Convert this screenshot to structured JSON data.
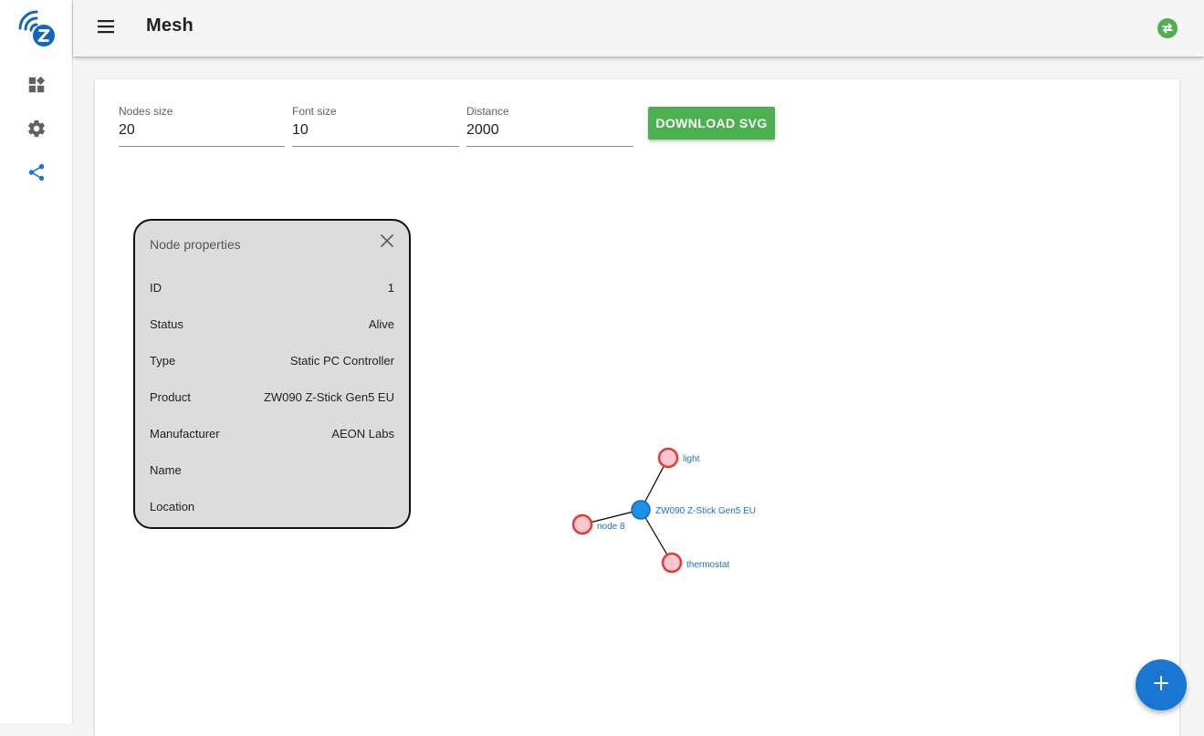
{
  "app": {
    "page_title": "Mesh",
    "colors": {
      "primary": "#1976d2",
      "download_button": "#4caf50",
      "status_ok": "#4caf50",
      "controller_node": "#1e90e8",
      "device_node_fill": "#f8c8cc",
      "device_node_stroke": "#e53935",
      "node_label": "#1e6fc2"
    }
  },
  "sidebar": {
    "logo": "zwave-logo-icon",
    "items": [
      {
        "icon": "dashboard-icon",
        "active": false
      },
      {
        "icon": "settings-gear-icon",
        "active": false
      },
      {
        "icon": "share-mesh-icon",
        "active": true
      }
    ]
  },
  "appbar": {
    "menu_icon": "menu-icon",
    "status_icon": "swap-horizontal-icon"
  },
  "controls": {
    "nodes_size": {
      "label": "Nodes size",
      "value": "20"
    },
    "font_size": {
      "label": "Font size",
      "value": "10"
    },
    "distance": {
      "label": "Distance",
      "value": "2000"
    },
    "download_label": "DOWNLOAD SVG"
  },
  "node_properties": {
    "title": "Node properties",
    "rows": [
      {
        "key": "ID",
        "value": "1"
      },
      {
        "key": "Status",
        "value": "Alive"
      },
      {
        "key": "Type",
        "value": "Static PC Controller"
      },
      {
        "key": "Product",
        "value": "ZW090 Z-Stick Gen5 EU"
      },
      {
        "key": "Manufacturer",
        "value": "AEON Labs"
      },
      {
        "key": "Name",
        "value": ""
      },
      {
        "key": "Location",
        "value": ""
      }
    ]
  },
  "mesh": {
    "nodes": [
      {
        "id": "controller",
        "label": "ZW090 Z-Stick Gen5 EU",
        "kind": "controller"
      },
      {
        "id": "light",
        "label": "light",
        "kind": "device"
      },
      {
        "id": "node8",
        "label": "node 8",
        "kind": "device"
      },
      {
        "id": "thermostat",
        "label": "thermostat",
        "kind": "device"
      }
    ],
    "links": [
      {
        "from": "controller",
        "to": "light"
      },
      {
        "from": "controller",
        "to": "node8"
      },
      {
        "from": "controller",
        "to": "thermostat"
      }
    ]
  },
  "fab": {
    "icon": "plus-icon"
  }
}
